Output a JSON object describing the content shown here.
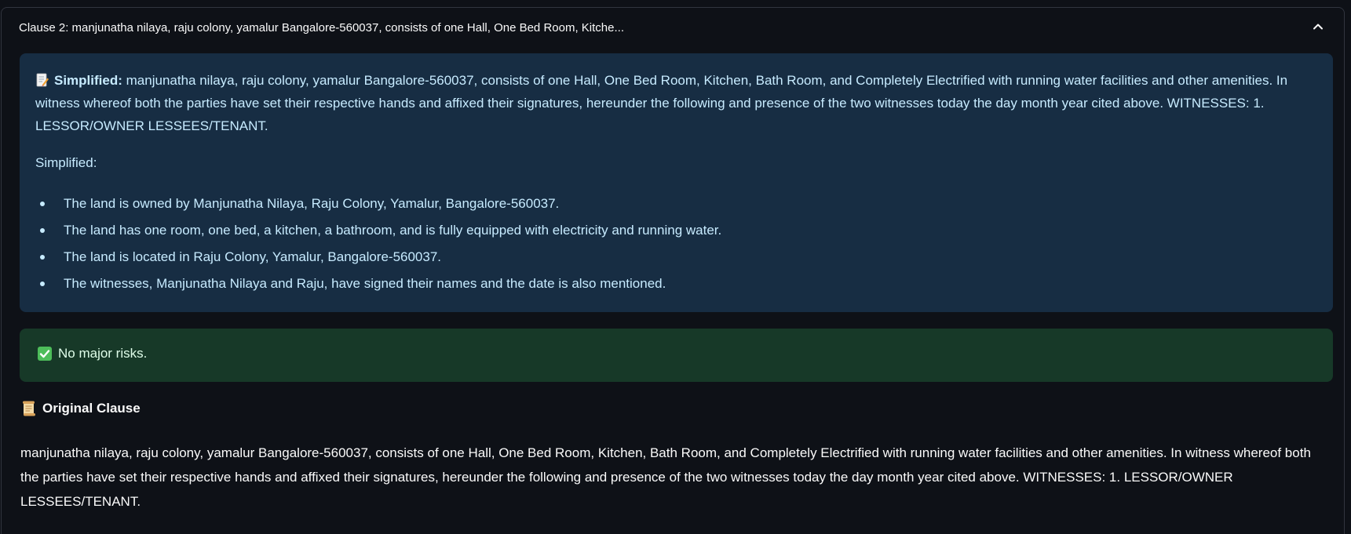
{
  "expander": {
    "title": "Clause 2: manjunatha nilaya, raju colony, yamalur Bangalore-560037, consists of one Hall, One Bed Room, Kitche...",
    "toggle_icon": "chevron-up-icon",
    "expanded": true
  },
  "info": {
    "icon": "memo-icon",
    "label": "Simplified:",
    "text": "manjunatha nilaya, raju colony, yamalur Bangalore-560037, consists of one Hall, One Bed Room, Kitchen, Bath Room, and Completely Electrified with running water facilities and other amenities. In witness whereof both the parties have set their respective hands and affixed their signatures, hereunder the following and presence of the two witnesses today the day month year cited above. WITNESSES: 1. LESSOR/OWNER LESSEES/TENANT.",
    "sub_label": "Simplified:",
    "bullets": [
      "The land is owned by Manjunatha Nilaya, Raju Colony, Yamalur, Bangalore-560037.",
      "The land has one room, one bed, a kitchen, a bathroom, and is fully equipped with electricity and running water.",
      "The land is located in Raju Colony, Yamalur, Bangalore-560037.",
      "The witnesses, Manjunatha Nilaya and Raju, have signed their names and the date is also mentioned."
    ]
  },
  "success": {
    "icon": "check-mark-icon",
    "text": "No major risks."
  },
  "original": {
    "icon": "scroll-icon",
    "heading": "Original Clause",
    "text": "manjunatha nilaya, raju colony, yamalur Bangalore-560037, consists of one Hall, One Bed Room, Kitchen, Bath Room, and Completely Electrified with running water facilities and other amenities. In witness whereof both the parties have set their respective hands and affixed their signatures, hereunder the following and presence of the two witnesses today the day month year cited above. WITNESSES: 1. LESSOR/OWNER LESSEES/TENANT."
  },
  "colors": {
    "background": "#0e1117",
    "info_bg": "#172d43",
    "info_text": "#c7ebff",
    "success_bg": "#173928",
    "success_text": "#dffde9",
    "border": "#31353f"
  }
}
